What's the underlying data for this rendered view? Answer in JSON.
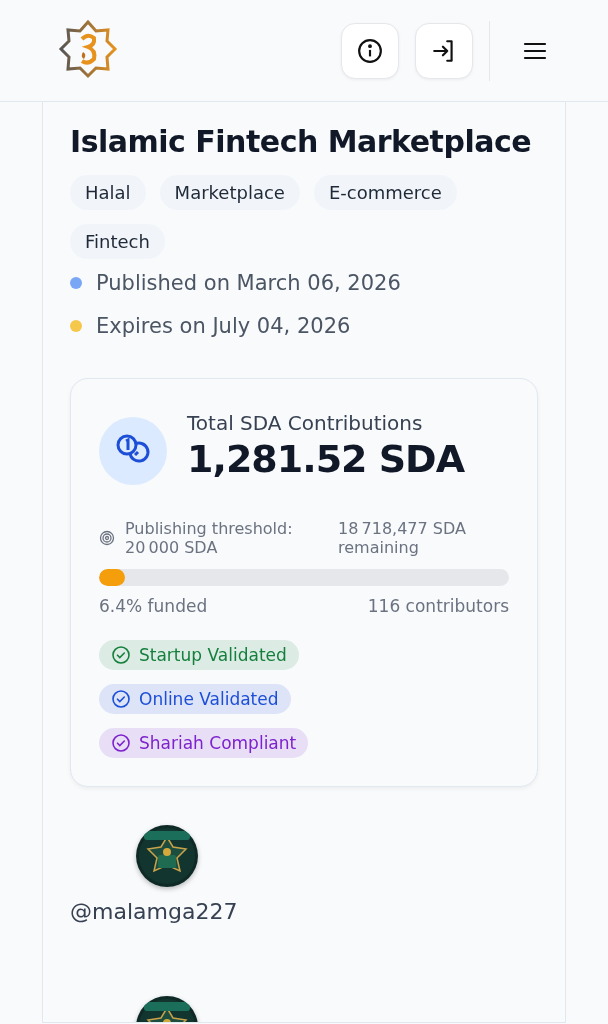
{
  "header": {
    "buttons": [
      {
        "kind": "info"
      },
      {
        "kind": "login"
      }
    ],
    "menu": {
      "kind": "menu"
    }
  },
  "listing": {
    "title": "Islamic Fintech Marketplace",
    "tags": [
      "Halal",
      "Marketplace",
      "E-commerce",
      "Fintech"
    ],
    "dates": [
      {
        "text": "Published on March 06, 2026",
        "color": "#7aa7f5"
      },
      {
        "text": "Expires on July 04, 2026",
        "color": "#f5c84c"
      }
    ],
    "contributions": {
      "label": "Total SDA Contributions",
      "amount": "1,281.52 SDA",
      "threshold": "Publishing threshold: 20 000 SDA",
      "remaining": "18 718,477 SDA remaining",
      "progress": {
        "level": 0.064
      },
      "funded": "6.4% funded",
      "contributors": "116 contributors",
      "badges": [
        {
          "text": "Startup Validated",
          "color": "#15803d"
        },
        {
          "text": "Online Validated",
          "color": "#1d4ed8"
        },
        {
          "text": "Shariah Compliant",
          "color": "#7e22ce"
        }
      ]
    },
    "creators": [
      {
        "kind": "picture",
        "username": "@malamga227"
      },
      {
        "kind": "picture"
      }
    ]
  }
}
